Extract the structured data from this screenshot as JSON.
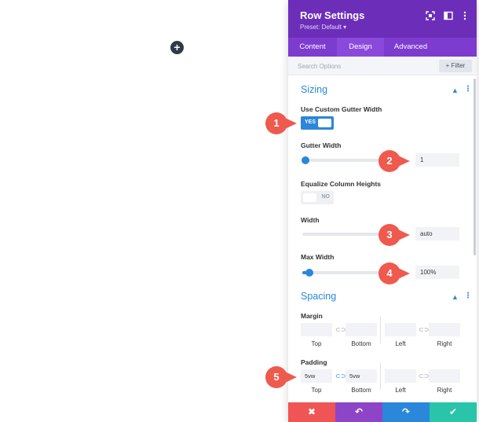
{
  "canvas": {
    "add_icon": "plus-icon"
  },
  "header": {
    "title": "Row Settings",
    "preset": "Preset: Default ▾",
    "icons": [
      "fullscreen-icon",
      "split-view-icon",
      "more-icon"
    ]
  },
  "tabs": [
    {
      "label": "Content",
      "active": false
    },
    {
      "label": "Design",
      "active": true
    },
    {
      "label": "Advanced",
      "active": false
    }
  ],
  "search": {
    "placeholder": "Search Options",
    "filter_label": "+ Filter"
  },
  "sizing": {
    "title": "Sizing",
    "custom_gutter": {
      "label": "Use Custom Gutter Width",
      "state": "YES"
    },
    "gutter_width": {
      "label": "Gutter Width",
      "value": "1",
      "fraction": 0.03
    },
    "equalize": {
      "label": "Equalize Column Heights",
      "state": "NO"
    },
    "width": {
      "label": "Width",
      "value": "auto"
    },
    "max_width": {
      "label": "Max Width",
      "value": "100%",
      "fraction": 0.07
    }
  },
  "spacing": {
    "title": "Spacing",
    "margin": {
      "label": "Margin",
      "top": "",
      "bottom": "",
      "left": "",
      "right": "",
      "captions": [
        "Top",
        "Bottom",
        "Left",
        "Right"
      ]
    },
    "padding": {
      "label": "Padding",
      "top": "5vw",
      "bottom": "5vw",
      "left": "",
      "right": "",
      "captions": [
        "Top",
        "Bottom",
        "Left",
        "Right"
      ]
    }
  },
  "footer": {
    "cancel_color": "#ef5555",
    "undo_color": "#8e44c6",
    "redo_color": "#2b87da",
    "save_color": "#29c4a9"
  },
  "markers": [
    "1",
    "2",
    "3",
    "4",
    "5"
  ],
  "colors": {
    "marker": "#ef5a4e",
    "accent": "#2b87da",
    "header": "#6c2eb9"
  }
}
